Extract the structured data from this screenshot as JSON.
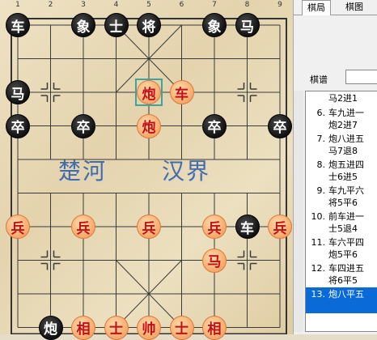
{
  "board": {
    "file_numbers": [
      "1",
      "2",
      "3",
      "4",
      "5",
      "6",
      "7",
      "8",
      "9"
    ],
    "river_left": "楚河",
    "river_right": "汉界",
    "pieces": [
      {
        "side": "black",
        "label": "车",
        "file": 0,
        "rank": 0
      },
      {
        "side": "black",
        "label": "象",
        "file": 2,
        "rank": 0
      },
      {
        "side": "black",
        "label": "士",
        "file": 3,
        "rank": 0
      },
      {
        "side": "black",
        "label": "将",
        "file": 4,
        "rank": 0
      },
      {
        "side": "black",
        "label": "象",
        "file": 6,
        "rank": 0
      },
      {
        "side": "black",
        "label": "马",
        "file": 7,
        "rank": 0
      },
      {
        "side": "black",
        "label": "马",
        "file": 0,
        "rank": 2
      },
      {
        "side": "red",
        "label": "炮",
        "file": 4,
        "rank": 2
      },
      {
        "side": "red",
        "label": "车",
        "file": 5,
        "rank": 2
      },
      {
        "side": "black",
        "label": "卒",
        "file": 0,
        "rank": 3
      },
      {
        "side": "black",
        "label": "卒",
        "file": 2,
        "rank": 3
      },
      {
        "side": "red",
        "label": "炮",
        "file": 4,
        "rank": 3
      },
      {
        "side": "black",
        "label": "卒",
        "file": 6,
        "rank": 3
      },
      {
        "side": "black",
        "label": "卒",
        "file": 8,
        "rank": 3
      },
      {
        "side": "red",
        "label": "兵",
        "file": 0,
        "rank": 6
      },
      {
        "side": "red",
        "label": "兵",
        "file": 2,
        "rank": 6
      },
      {
        "side": "red",
        "label": "兵",
        "file": 4,
        "rank": 6
      },
      {
        "side": "red",
        "label": "兵",
        "file": 6,
        "rank": 6
      },
      {
        "side": "black",
        "label": "车",
        "file": 7,
        "rank": 6
      },
      {
        "side": "red",
        "label": "兵",
        "file": 8,
        "rank": 6
      },
      {
        "side": "red",
        "label": "马",
        "file": 6,
        "rank": 7
      },
      {
        "side": "black",
        "label": "炮",
        "file": 1,
        "rank": 9
      },
      {
        "side": "red",
        "label": "相",
        "file": 2,
        "rank": 9
      },
      {
        "side": "red",
        "label": "士",
        "file": 3,
        "rank": 9
      },
      {
        "side": "red",
        "label": "帅",
        "file": 4,
        "rank": 9
      },
      {
        "side": "red",
        "label": "士",
        "file": 5,
        "rank": 9
      },
      {
        "side": "red",
        "label": "相",
        "file": 6,
        "rank": 9
      }
    ],
    "selected": {
      "file": 4,
      "rank": 2
    }
  },
  "panel": {
    "tabs": [
      "棋局",
      "棋图"
    ],
    "record_label": "棋谱",
    "moves": [
      {
        "num": "",
        "line1": "马2进1",
        "line2": ""
      },
      {
        "num": "6.",
        "line1": "车九进一",
        "line2": "炮2进7"
      },
      {
        "num": "7.",
        "line1": "炮八进五",
        "line2": "马7退8"
      },
      {
        "num": "8.",
        "line1": "炮五进四",
        "line2": "士6进5"
      },
      {
        "num": "9.",
        "line1": "车九平六",
        "line2": "将5平6"
      },
      {
        "num": "10.",
        "line1": "前车进一",
        "line2": "士5退4"
      },
      {
        "num": "11.",
        "line1": "车六平四",
        "line2": "炮5平6"
      },
      {
        "num": "12.",
        "line1": "车四进五",
        "line2": "将6平5"
      },
      {
        "num": "13.",
        "line1": "炮八平五",
        "line2": ""
      }
    ],
    "selected_move": 8,
    "colors": {
      "selected_bg": "#0a6ad8"
    }
  }
}
